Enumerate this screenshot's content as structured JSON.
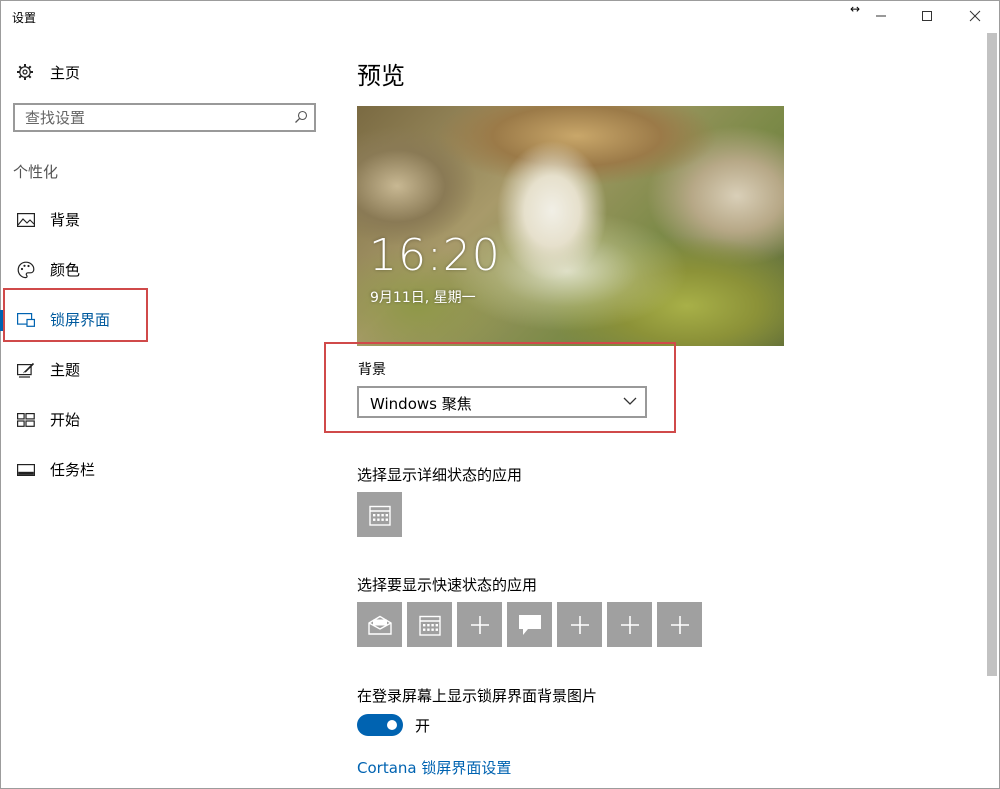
{
  "window": {
    "title": "设置",
    "controls": {
      "minimize": "—",
      "maximize": "☐",
      "close": "✕"
    }
  },
  "sidebar": {
    "home_label": "主页",
    "search_placeholder": "查找设置",
    "section_label": "个性化",
    "items": [
      {
        "label": "背景",
        "icon": "image-icon",
        "active": false
      },
      {
        "label": "颜色",
        "icon": "palette-icon",
        "active": false
      },
      {
        "label": "锁屏界面",
        "icon": "lock-screen-icon",
        "active": true
      },
      {
        "label": "主题",
        "icon": "theme-icon",
        "active": false
      },
      {
        "label": "开始",
        "icon": "start-icon",
        "active": false
      },
      {
        "label": "任务栏",
        "icon": "taskbar-icon",
        "active": false
      }
    ]
  },
  "main": {
    "title": "预览",
    "preview": {
      "time": "16:20",
      "date": "9月11日, 星期一"
    },
    "background_label": "背景",
    "background_value": "Windows 聚焦",
    "detailed_status_label": "选择显示详细状态的应用",
    "detailed_status_apps": [
      "calendar-icon"
    ],
    "quick_status_label": "选择要显示快速状态的应用",
    "quick_status_apps": [
      "mail-icon",
      "calendar-icon",
      "plus-icon",
      "message-icon",
      "plus-icon",
      "plus-icon",
      "plus-icon"
    ],
    "signin_bg_label": "在登录屏幕上显示锁屏界面背景图片",
    "toggle_state": "开",
    "toggle_on": true,
    "cortana_link": "Cortana 锁屏界面设置"
  },
  "colors": {
    "accent": "#0063b1",
    "highlight_box": "#d04a4a",
    "tile": "#a0a0a0"
  }
}
